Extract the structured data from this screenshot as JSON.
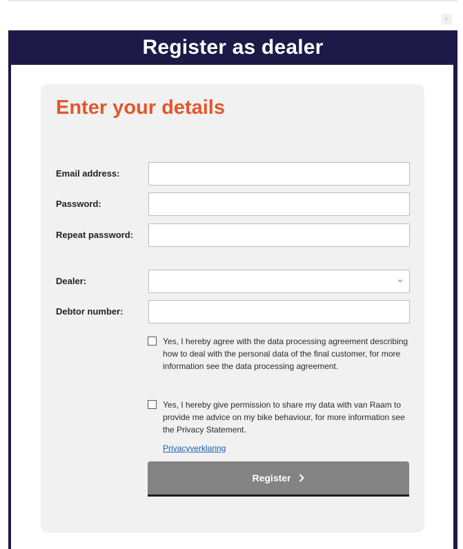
{
  "window": {
    "close_glyph": "×"
  },
  "header": {
    "title": "Register as dealer"
  },
  "form": {
    "title": "Enter your details",
    "fields": [
      {
        "label": "Email address:",
        "value": "",
        "type": "text"
      },
      {
        "label": "Password:",
        "value": "",
        "type": "password"
      },
      {
        "label": "Repeat password:",
        "value": "",
        "type": "password"
      }
    ],
    "dealer": {
      "label": "Dealer:",
      "selected": ""
    },
    "debtor": {
      "label": "Debtor number:",
      "value": ""
    },
    "consents": [
      {
        "text": "Yes, I hereby agree with the data processing agreement describing how to deal with the personal data of the final customer, for more information see the data processing agreement.",
        "checked": false
      },
      {
        "text": "Yes, I hereby give permission to share my data with van Raam to provide me advice on my bike behaviour, for more information see the Privacy Statement.",
        "checked": false
      }
    ],
    "privacy_link": "Privacyverklaring",
    "submit_label": "Register",
    "submit_icon": "chevron-right-icon"
  },
  "colors": {
    "header_bg": "#1e1a47",
    "title_accent": "#e2572a",
    "button_bg": "#838383",
    "card_bg": "#f1f1f1",
    "link": "#1a5fb4"
  }
}
